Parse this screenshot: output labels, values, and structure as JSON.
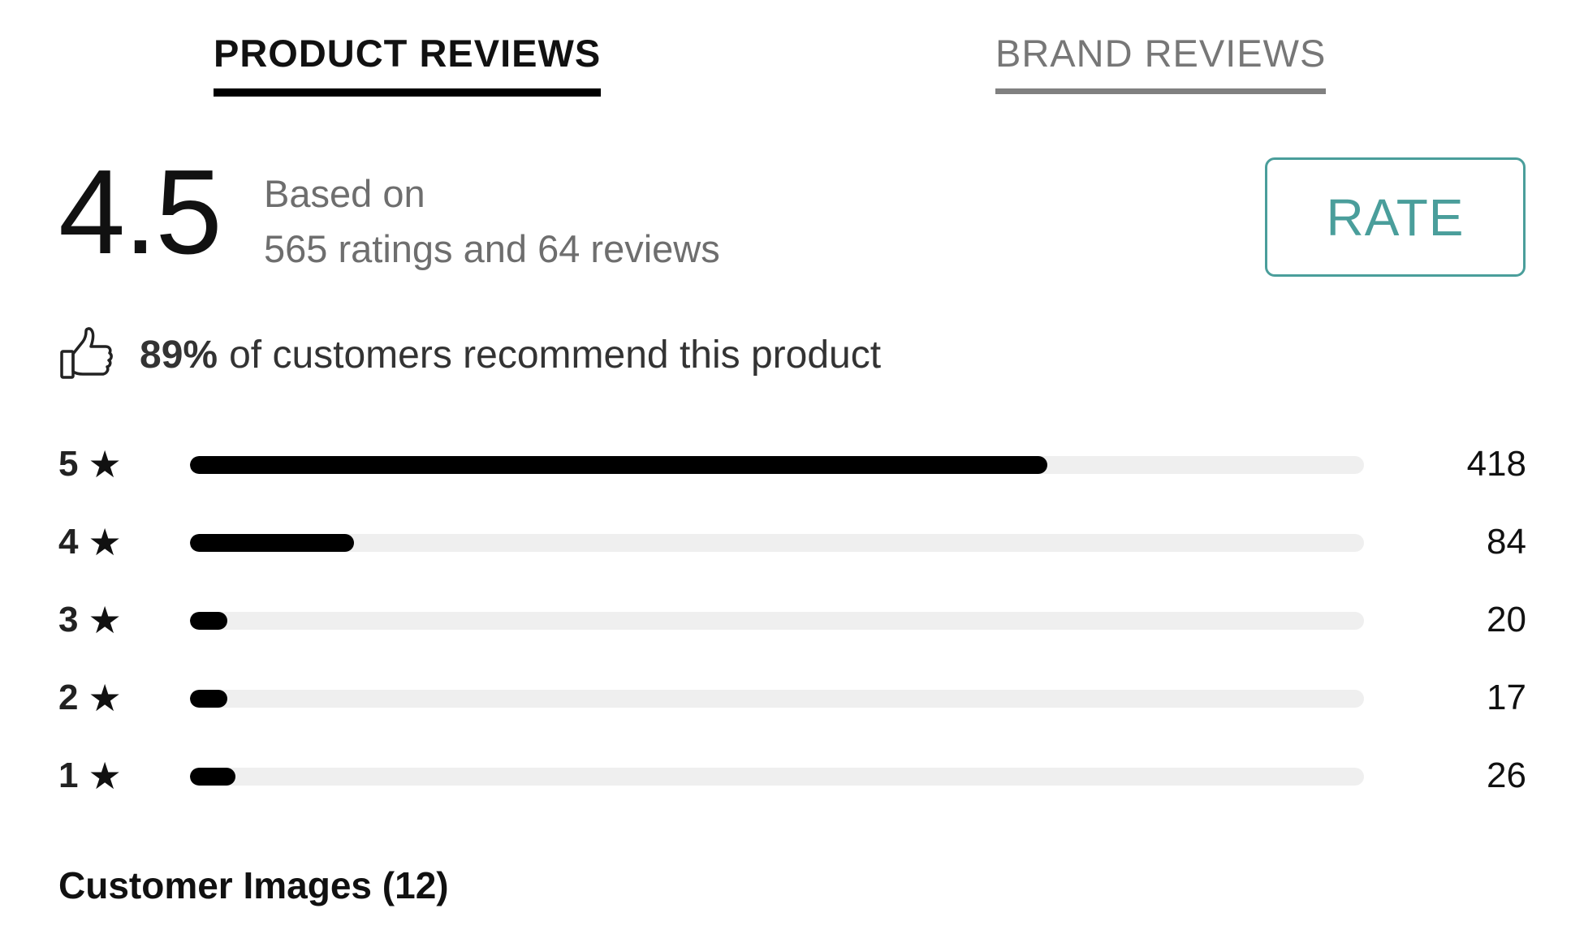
{
  "tabs": [
    {
      "label": "PRODUCT REVIEWS",
      "active": true
    },
    {
      "label": "BRAND REVIEWS",
      "active": false
    }
  ],
  "summary": {
    "average_rating": "4.5",
    "based_on_line1": "Based on",
    "based_on_line2": "565 ratings and 64 reviews"
  },
  "rate_button": {
    "label": "RATE"
  },
  "recommend": {
    "icon": "thumbs-up-icon",
    "percent": "89%",
    "text": "of customers recommend this product"
  },
  "distribution": {
    "star_icon": "★",
    "rows": [
      {
        "stars": "5",
        "count": "418",
        "fraction": 0.73
      },
      {
        "stars": "4",
        "count": "84",
        "fraction": 0.14
      },
      {
        "stars": "3",
        "count": "20",
        "fraction": 0.032
      },
      {
        "stars": "2",
        "count": "17",
        "fraction": 0.032
      },
      {
        "stars": "1",
        "count": "26",
        "fraction": 0.039
      }
    ]
  },
  "customer_images": {
    "label": "Customer Images (12)"
  },
  "colors": {
    "accent": "#4a9e9b",
    "bar_fill": "#000000",
    "bar_track": "#efefef",
    "muted_text": "#6e6e6e"
  }
}
